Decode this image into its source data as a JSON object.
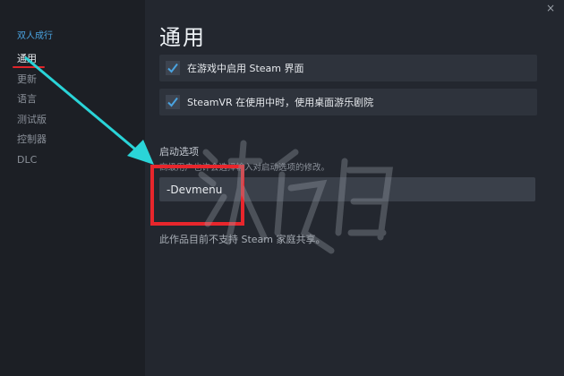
{
  "sidebar": {
    "game_title": "双人成行",
    "items": [
      {
        "label": "通用",
        "active": true
      },
      {
        "label": "更新"
      },
      {
        "label": "语言"
      },
      {
        "label": "测试版"
      },
      {
        "label": "控制器"
      },
      {
        "label": "DLC"
      }
    ]
  },
  "main": {
    "title": "通用",
    "options": [
      {
        "label": "在游戏中启用 Steam 界面",
        "checked": true
      },
      {
        "label": "SteamVR 在使用中时，使用桌面游乐剧院",
        "checked": true
      }
    ],
    "launch_options": {
      "label": "启动选项",
      "hint": "高级用户也许会选择输入对启动选项的修改。",
      "value": "-Devmenu"
    },
    "family_sharing_note": "此作品目前不支持 Steam 家庭共享。"
  },
  "window": {
    "close_glyph": "×"
  },
  "colors": {
    "accent_blue": "#4aa3e0",
    "annotation_red": "#e8262c",
    "arrow_cyan": "#2ad4d8"
  }
}
